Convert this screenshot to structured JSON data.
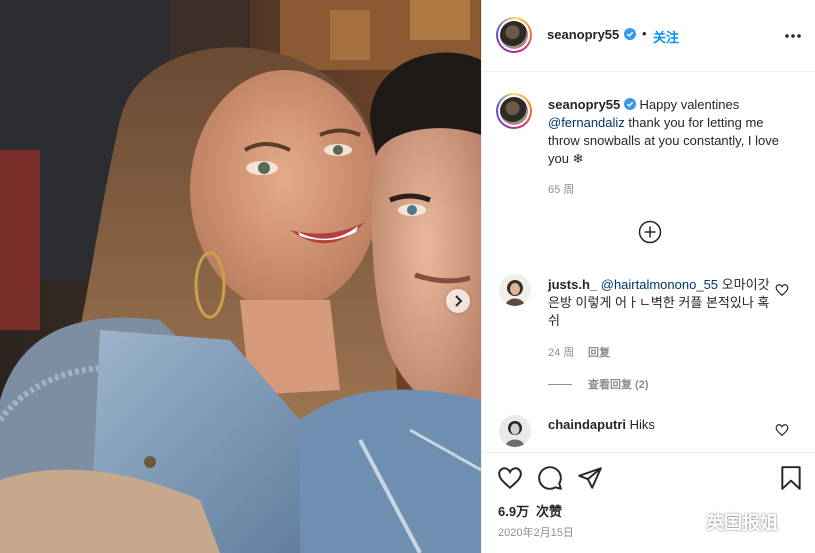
{
  "header": {
    "username": "seanopry55",
    "dot": "•",
    "follow_label": "关注",
    "verified_icon": "verified-badge-icon",
    "more_icon": "more-options-icon"
  },
  "caption": {
    "username": "seanopry55",
    "text_before": " Happy valentines ",
    "mention": "@fernandaliz",
    "text_after": " thank you for letting me throw snowballs at you constantly, I love you ❄",
    "time": "65 周"
  },
  "comments": [
    {
      "username": "justs.h_",
      "mention": "@hairtalmonono_55",
      "text": " 오마이갓 은방 이렇게 어ㅏㄴ벽한 커플 본적있나 혹쉬",
      "time": "24 周",
      "reply_label": "回复",
      "view_replies_label": "查看回复 (2)"
    },
    {
      "username": "chaindaputri",
      "text": " Hiks"
    }
  ],
  "actions": {
    "likes_count": "6.9万",
    "likes_label": "次赞",
    "date": "2020年2月15日"
  },
  "watermark": {
    "text": "英国报姐"
  },
  "colors": {
    "link_blue": "#0095f6",
    "mention_blue": "#00376b",
    "muted": "#8e8e8e",
    "text": "#262626"
  }
}
